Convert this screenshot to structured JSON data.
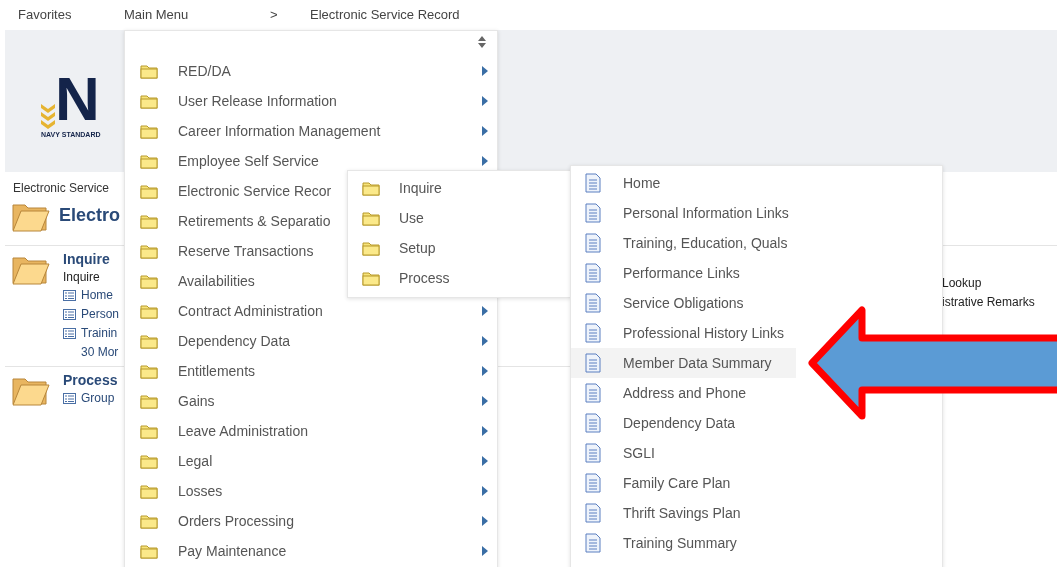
{
  "top_bar": {
    "favorites": "Favorites",
    "main_menu": "Main Menu",
    "separator": ">",
    "current": "Electronic Service Record"
  },
  "logo": {
    "letter": "N",
    "caption": "NAVY STANDARD"
  },
  "page": {
    "breadcrumb": "Electronic Service",
    "title": "Electro",
    "sections": [
      {
        "title": "Inquire",
        "subtitle": "Inquire",
        "links": [
          "Home",
          "Person",
          "Trainin"
        ],
        "more": "30 Mor",
        "right_links": [
          "Lookup",
          "istrative Remarks"
        ]
      },
      {
        "title": "Process",
        "links": [
          "Group"
        ]
      }
    ]
  },
  "main_menu": {
    "items": [
      {
        "label": "RED/DA",
        "arrow": true
      },
      {
        "label": "User Release Information",
        "arrow": true
      },
      {
        "label": "Career Information Management",
        "arrow": true
      },
      {
        "label": "Employee Self Service",
        "arrow": true
      },
      {
        "label": "Electronic Service Recor",
        "arrow": false
      },
      {
        "label": "Retirements & Separatio",
        "arrow": false
      },
      {
        "label": "Reserve Transactions",
        "arrow": false
      },
      {
        "label": "Availabilities",
        "arrow": false
      },
      {
        "label": "Contract Administration",
        "arrow": true
      },
      {
        "label": "Dependency Data",
        "arrow": true
      },
      {
        "label": "Entitlements",
        "arrow": true
      },
      {
        "label": "Gains",
        "arrow": true
      },
      {
        "label": "Leave Administration",
        "arrow": true
      },
      {
        "label": "Legal",
        "arrow": true
      },
      {
        "label": "Losses",
        "arrow": true
      },
      {
        "label": "Orders Processing",
        "arrow": true
      },
      {
        "label": "Pay Maintenance",
        "arrow": true
      }
    ]
  },
  "submenu": {
    "items": [
      {
        "label": "Inquire"
      },
      {
        "label": "Use"
      },
      {
        "label": "Setup"
      },
      {
        "label": "Process"
      }
    ]
  },
  "inquire_menu": {
    "items": [
      {
        "label": "Home",
        "selected": false
      },
      {
        "label": "Personal Information Links",
        "selected": false
      },
      {
        "label": "Training, Education, Quals",
        "selected": false
      },
      {
        "label": "Performance Links",
        "selected": false
      },
      {
        "label": "Service Obligations",
        "selected": false
      },
      {
        "label": "Professional History Links",
        "selected": false
      },
      {
        "label": "Member Data Summary",
        "selected": true
      },
      {
        "label": "Address and Phone",
        "selected": false
      },
      {
        "label": "Dependency Data",
        "selected": false
      },
      {
        "label": "SGLI",
        "selected": false
      },
      {
        "label": "Family Care Plan",
        "selected": false
      },
      {
        "label": "Thrift Savings Plan",
        "selected": false
      },
      {
        "label": "Training Summary",
        "selected": false
      }
    ]
  }
}
